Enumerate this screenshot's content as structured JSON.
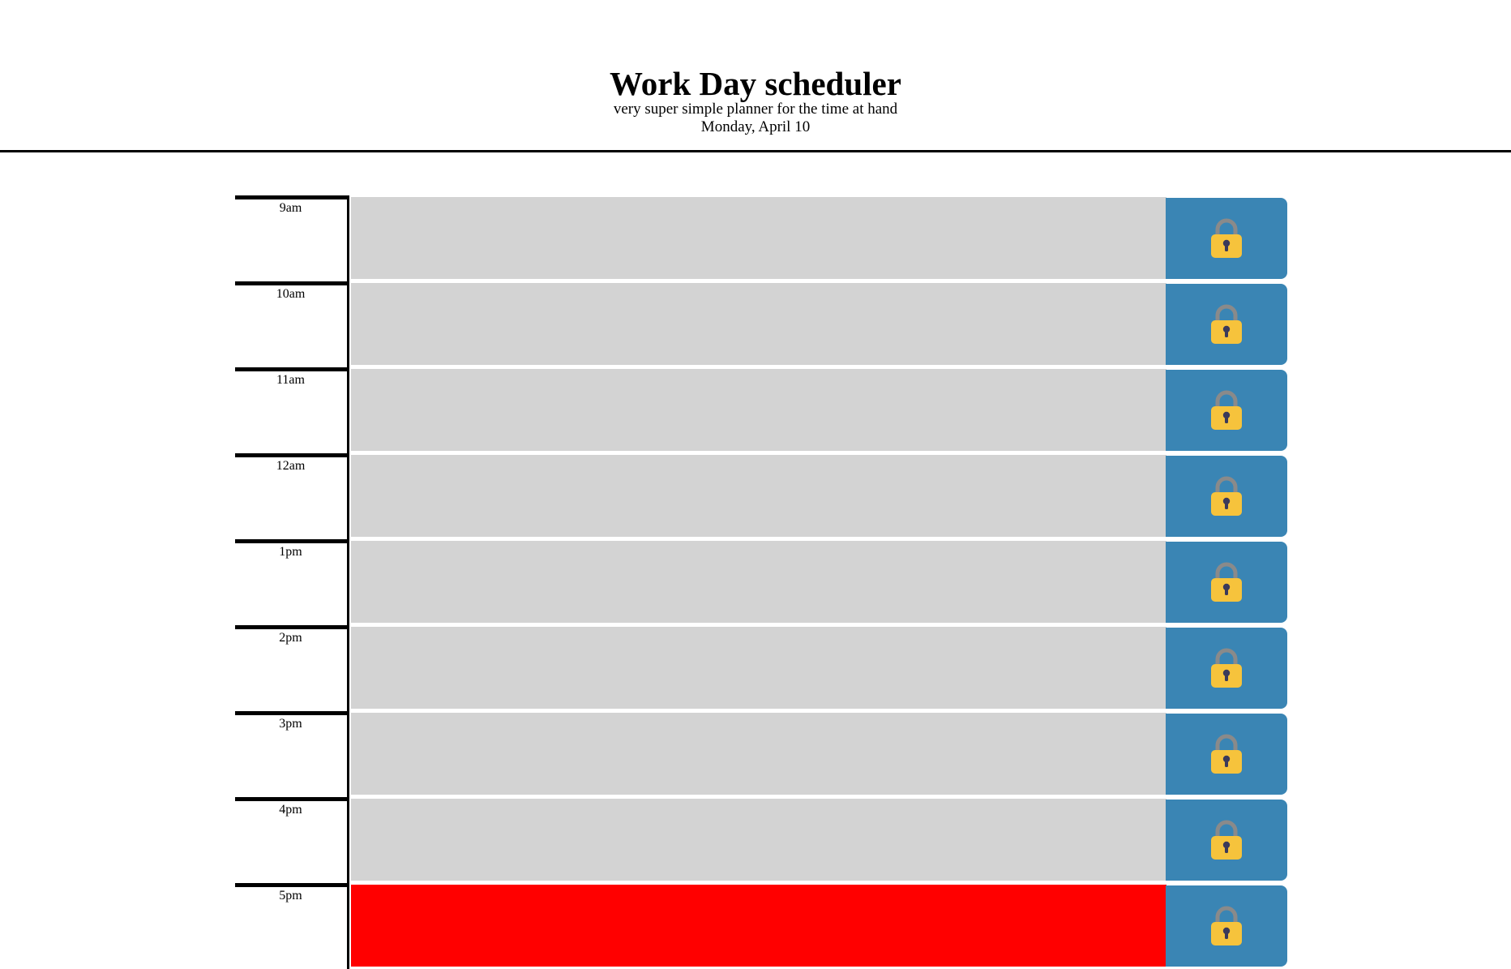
{
  "header": {
    "title": "Work Day scheduler",
    "subtitle": "very super simple planner for the time at hand",
    "current_day": "Monday, April 10"
  },
  "colors": {
    "past": "#d3d3d3",
    "present": "#ff0000",
    "save_button": "#3a85b4",
    "lock_body": "#f6c33c",
    "lock_shackle": "#8a8a8a",
    "keyhole": "#3b3a5a"
  },
  "time_blocks": [
    {
      "hour": "9am",
      "status": "past",
      "text": "",
      "save_icon": "lock-icon"
    },
    {
      "hour": "10am",
      "status": "past",
      "text": "",
      "save_icon": "lock-icon"
    },
    {
      "hour": "11am",
      "status": "past",
      "text": "",
      "save_icon": "lock-icon"
    },
    {
      "hour": "12am",
      "status": "past",
      "text": "",
      "save_icon": "lock-icon"
    },
    {
      "hour": "1pm",
      "status": "past",
      "text": "",
      "save_icon": "lock-icon"
    },
    {
      "hour": "2pm",
      "status": "past",
      "text": "",
      "save_icon": "lock-icon"
    },
    {
      "hour": "3pm",
      "status": "past",
      "text": "",
      "save_icon": "lock-icon"
    },
    {
      "hour": "4pm",
      "status": "past",
      "text": "",
      "save_icon": "lock-icon"
    },
    {
      "hour": "5pm",
      "status": "present",
      "text": "",
      "save_icon": "lock-icon"
    }
  ]
}
